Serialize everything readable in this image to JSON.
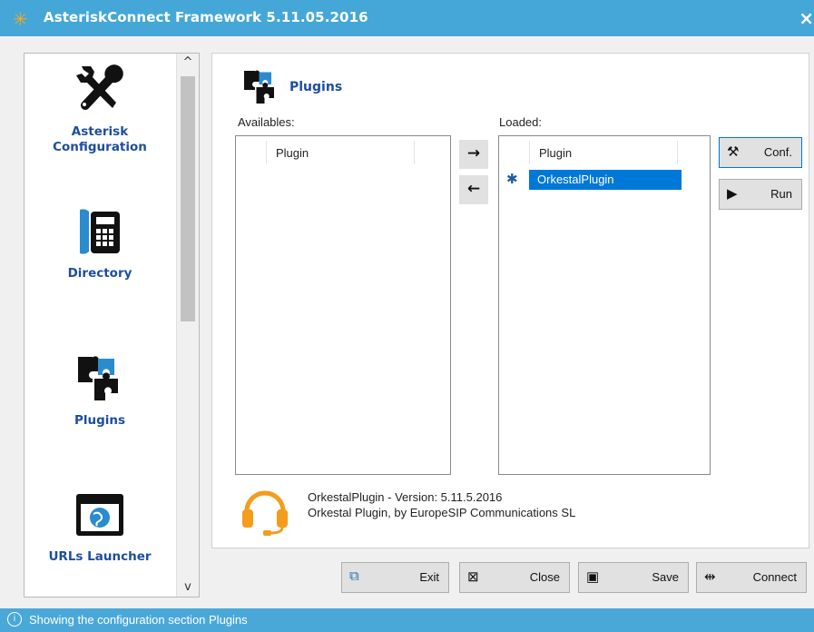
{
  "window": {
    "title": "AsteriskConnect Framework 5.11.05.2016",
    "close_glyph": "×",
    "app_icon": "asterisk-icon"
  },
  "nav": {
    "items": [
      {
        "label_line1": "Asterisk",
        "label_line2": "Configuration",
        "icon": "tools-icon"
      },
      {
        "label_line1": "Directory",
        "label_line2": "",
        "icon": "phone-directory-icon"
      },
      {
        "label_line1": "Plugins",
        "label_line2": "",
        "icon": "puzzle-icon"
      },
      {
        "label_line1": "URLs Launcher",
        "label_line2": "",
        "icon": "globe-window-icon"
      }
    ],
    "scroll_up": "^",
    "scroll_down": "v"
  },
  "section": {
    "title": "Plugins"
  },
  "availables": {
    "label": "Availables:",
    "column_header": "Plugin",
    "rows": []
  },
  "loaded": {
    "label": "Loaded:",
    "column_header": "Plugin",
    "rows": [
      "OrkestalPlugin"
    ],
    "selected_index": 0
  },
  "arrows": {
    "add": "→",
    "remove": "←"
  },
  "side_buttons": {
    "conf": "Conf.",
    "run": "Run"
  },
  "plugin_info": {
    "line1": "OrkestalPlugin - Version: 5.11.5.2016",
    "line2": "Orkestal Plugin, by EuropeSIP Communications SL"
  },
  "bottom_buttons": {
    "exit": "Exit",
    "close": "Close",
    "save": "Save",
    "connect": "Connect"
  },
  "status": {
    "text": "Showing the configuration section Plugins"
  },
  "colors": {
    "titlebar": "#44a7d8",
    "link_blue": "#1d4e9e",
    "selection": "#0078d7",
    "headset_orange": "#f39c1e"
  }
}
